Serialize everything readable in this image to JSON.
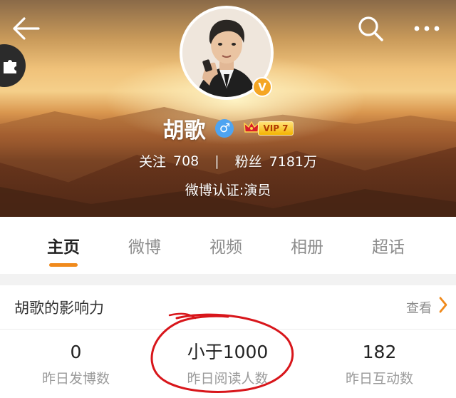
{
  "header": {
    "icons": {
      "back": "back-arrow-icon",
      "search": "search-icon",
      "more": "more-dots-icon",
      "side": "puzzle-icon",
      "verified": "verified-v-icon",
      "gender": "male-icon",
      "vip": "crown-icon"
    },
    "verified_mark": "V",
    "name": "胡歌",
    "gender_symbol": "♂",
    "vip_label": "VIP 7",
    "follow_label": "关注",
    "follow_count": "708",
    "separator": "|",
    "fans_label": "粉丝",
    "fans_count": "7181万",
    "verification": "微博认证:演员"
  },
  "tabs": [
    {
      "label": "主页",
      "active": true
    },
    {
      "label": "微博",
      "active": false
    },
    {
      "label": "视频",
      "active": false
    },
    {
      "label": "相册",
      "active": false
    },
    {
      "label": "超话",
      "active": false
    }
  ],
  "influence": {
    "title": "胡歌的影响力",
    "more_label": "查看",
    "metrics": [
      {
        "value": "0",
        "label": "昨日发博数"
      },
      {
        "value": "小于1000",
        "label": "昨日阅读人数"
      },
      {
        "value": "182",
        "label": "昨日互动数"
      }
    ]
  },
  "colors": {
    "accent": "#f08a1c",
    "verified": "#f5a623",
    "gender": "#4ea4f1",
    "annotation": "#d8161b"
  }
}
